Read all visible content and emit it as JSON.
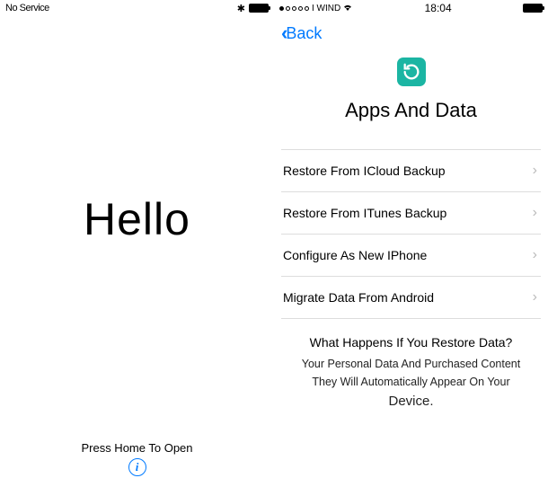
{
  "left": {
    "carrier": "No Service",
    "hello": "Hello",
    "press_home": "Press Home To Open"
  },
  "right": {
    "carrier": "I WIND",
    "time": "18:04",
    "back": "Back",
    "title": "Apps And Data",
    "options": [
      "Restore From ICloud Backup",
      "Restore From ITunes Backup",
      "Configure As New IPhone",
      "Migrate Data From Android"
    ],
    "footer_title": "What Happens If You Restore Data?",
    "footer_line1": "Your Personal Data And Purchased Content",
    "footer_line2": "They Will Automatically Appear On Your",
    "footer_line3": "Device."
  }
}
